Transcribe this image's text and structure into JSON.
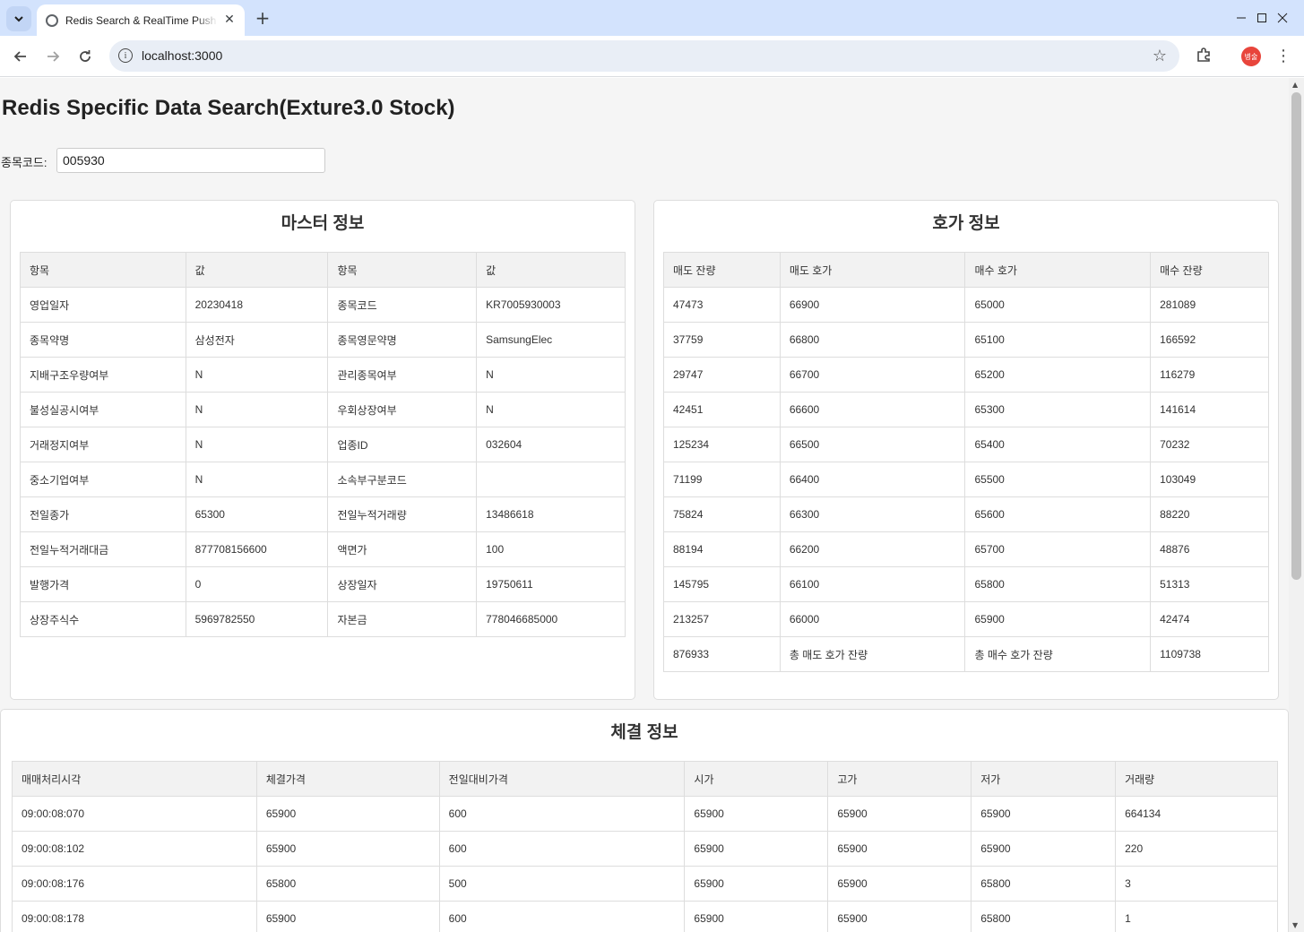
{
  "browser": {
    "tab_title": "Redis Search & RealTime Push",
    "url": "localhost:3000",
    "profile_label": "병술"
  },
  "page": {
    "title": "Redis Specific Data Search(Exture3.0 Stock)",
    "code_label": "종목코드:",
    "code_value": "005930"
  },
  "master": {
    "title": "마스터 정보",
    "headers": [
      "항목",
      "값",
      "항목",
      "값"
    ],
    "rows": [
      [
        "영업일자",
        "20230418",
        "종목코드",
        "KR7005930003"
      ],
      [
        "종목약명",
        "삼성전자",
        "종목영문약명",
        "SamsungElec"
      ],
      [
        "지배구조우량여부",
        "N",
        "관리종목여부",
        "N"
      ],
      [
        "불성실공시여부",
        "N",
        "우회상장여부",
        "N"
      ],
      [
        "거래정지여부",
        "N",
        "업종ID",
        "032604"
      ],
      [
        "중소기업여부",
        "N",
        "소속부구분코드",
        ""
      ],
      [
        "전일종가",
        "65300",
        "전일누적거래량",
        "13486618"
      ],
      [
        "전일누적거래대금",
        "877708156600",
        "액면가",
        "100"
      ],
      [
        "발행가격",
        "0",
        "상장일자",
        "19750611"
      ],
      [
        "상장주식수",
        "5969782550",
        "자본금",
        "778046685000"
      ]
    ]
  },
  "quote": {
    "title": "호가 정보",
    "headers": [
      "매도 잔량",
      "매도 호가",
      "매수 호가",
      "매수 잔량"
    ],
    "rows": [
      [
        "47473",
        "66900",
        "65000",
        "281089"
      ],
      [
        "37759",
        "66800",
        "65100",
        "166592"
      ],
      [
        "29747",
        "66700",
        "65200",
        "116279"
      ],
      [
        "42451",
        "66600",
        "65300",
        "141614"
      ],
      [
        "125234",
        "66500",
        "65400",
        "70232"
      ],
      [
        "71199",
        "66400",
        "65500",
        "103049"
      ],
      [
        "75824",
        "66300",
        "65600",
        "88220"
      ],
      [
        "88194",
        "66200",
        "65700",
        "48876"
      ],
      [
        "145795",
        "66100",
        "65800",
        "51313"
      ],
      [
        "213257",
        "66000",
        "65900",
        "42474"
      ],
      [
        "876933",
        "총 매도 호가 잔량",
        "총 매수 호가 잔량",
        "1109738"
      ]
    ]
  },
  "trade": {
    "title": "체결 정보",
    "headers": [
      "매매처리시각",
      "체결가격",
      "전일대비가격",
      "시가",
      "고가",
      "저가",
      "거래량"
    ],
    "rows": [
      [
        "09:00:08:070",
        "65900",
        "600",
        "65900",
        "65900",
        "65900",
        "664134"
      ],
      [
        "09:00:08:102",
        "65900",
        "600",
        "65900",
        "65900",
        "65900",
        "220"
      ],
      [
        "09:00:08:176",
        "65800",
        "500",
        "65900",
        "65900",
        "65800",
        "3"
      ],
      [
        "09:00:08:178",
        "65900",
        "600",
        "65900",
        "65900",
        "65800",
        "1"
      ]
    ]
  }
}
